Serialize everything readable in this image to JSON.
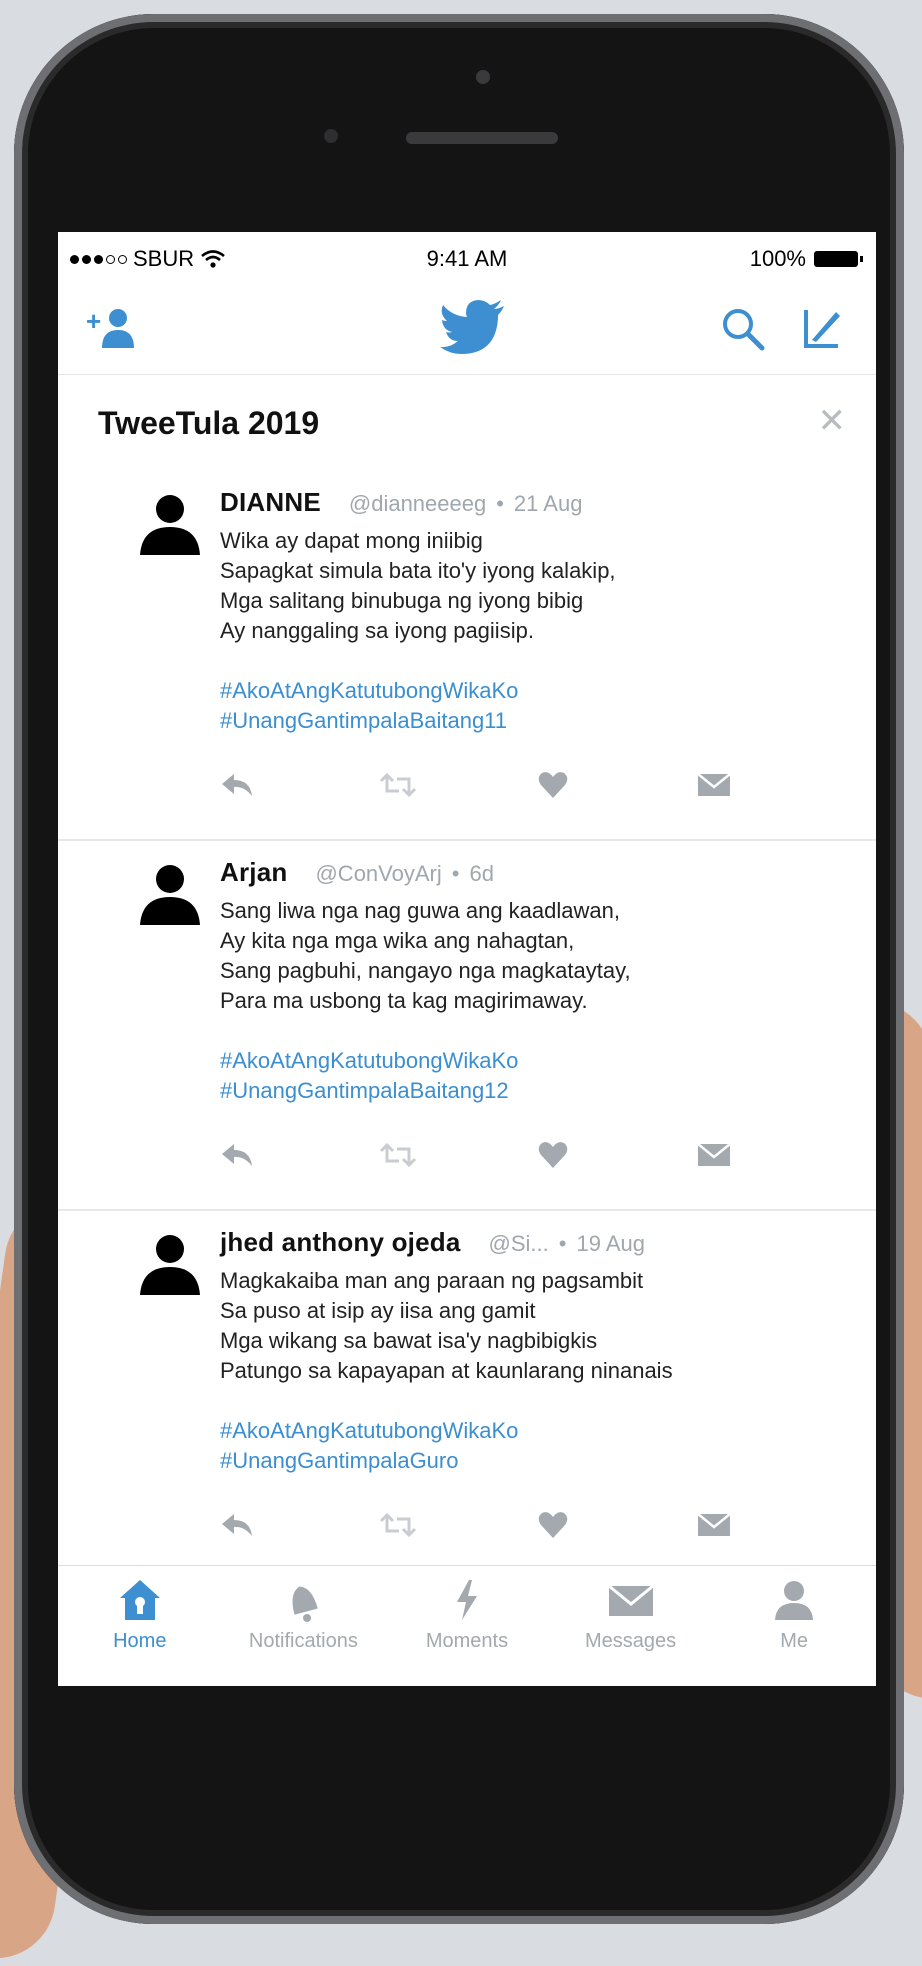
{
  "status": {
    "carrier": "SBUR",
    "time": "9:41 AM",
    "battery": "100%"
  },
  "timeline": {
    "title": "TweeTula 2019"
  },
  "tweets": [
    {
      "name": "DIANNE",
      "handle": "@dianneeeeg",
      "time": "21 Aug",
      "lines": [
        "Wika ay dapat mong iniibig",
        "Sapagkat simula bata ito'y iyong kalakip,",
        "Mga salitang binubuga ng iyong bibig",
        "Ay nanggaling sa iyong pagiisip."
      ],
      "tags": [
        "#AkoAtAngKatutubongWikaKo",
        "#UnangGantimpalaBaitang11"
      ]
    },
    {
      "name": "Arjan",
      "handle": "@ConVoyArj",
      "time": "6d",
      "lines": [
        "Sang liwa nga nag guwa ang kaadlawan,",
        "Ay kita nga mga wika ang nahagtan,",
        "Sang pagbuhi, nangayo nga magkataytay,",
        "Para ma usbong ta kag magirimaway."
      ],
      "tags": [
        "#AkoAtAngKatutubongWikaKo",
        "#UnangGantimpalaBaitang12"
      ]
    },
    {
      "name": "jhed anthony ojeda",
      "handle": "@Si...",
      "time": "19 Aug",
      "lines": [
        "Magkakaiba man ang paraan ng pagsambit",
        "Sa puso at isip ay iisa ang gamit",
        "Mga wikang sa bawat isa'y nagbibigkis",
        "Patungo sa kapayapan at kaunlarang ninanais"
      ],
      "tags": [
        "#AkoAtAngKatutubongWikaKo",
        "#UnangGantimpalaGuro"
      ]
    }
  ],
  "tabs": [
    {
      "label": "Home",
      "icon": "home-icon",
      "active": true
    },
    {
      "label": "Notifications",
      "icon": "bell-icon"
    },
    {
      "label": "Moments",
      "icon": "lightning-icon"
    },
    {
      "label": "Messages",
      "icon": "envelope-icon"
    },
    {
      "label": "Me",
      "icon": "person-icon"
    }
  ],
  "colors": {
    "accent": "#3d8fd1",
    "hashtag": "#3b8ed0",
    "muted": "#a0a7ad"
  }
}
